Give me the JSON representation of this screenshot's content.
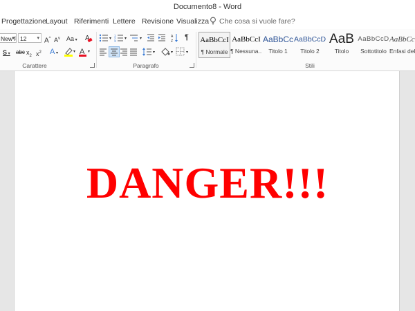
{
  "window": {
    "title": "Documento8  -  Word"
  },
  "tabs": [
    {
      "label": "Progettazione"
    },
    {
      "label": "Layout"
    },
    {
      "label": "Riferimenti"
    },
    {
      "label": "Lettere"
    },
    {
      "label": "Revisione"
    },
    {
      "label": "Visualizza"
    }
  ],
  "tell_me": {
    "placeholder": "Che cosa si vuole fare?",
    "icon": "lightbulb-icon"
  },
  "ribbon": {
    "font": {
      "name": "New F",
      "size": "12",
      "grow_label": "A",
      "shrink_label": "A",
      "case_label": "Aa",
      "strike_label": "abc",
      "sub_label": "x",
      "sup_label": "x",
      "underline_label": "S",
      "text_effect_label": "A",
      "font_color_label": "A",
      "font_color": "#e81123",
      "highlight_color": "#ffff00",
      "group_label": "Carattere"
    },
    "paragraph": {
      "pilcrow": "¶",
      "group_label": "Paragrafo"
    },
    "styles": {
      "group_label": "Stili",
      "items": [
        {
          "sample": "AaBbCcI",
          "name": "¶ Normale",
          "selected": true
        },
        {
          "sample": "AaBbCcI",
          "name": "¶ Nessuna..."
        },
        {
          "sample": "AaBbCc",
          "name": "Titolo 1"
        },
        {
          "sample": "AaBbCcD",
          "name": "Titolo 2"
        },
        {
          "sample": "AaB",
          "name": "Titolo"
        },
        {
          "sample": "AaBbCcD",
          "name": "Sottotitolo"
        },
        {
          "sample": "AaBbCc",
          "name": "Enfasi deli"
        }
      ]
    }
  },
  "document": {
    "text": "DANGER!!!",
    "text_color": "#ff0000"
  }
}
